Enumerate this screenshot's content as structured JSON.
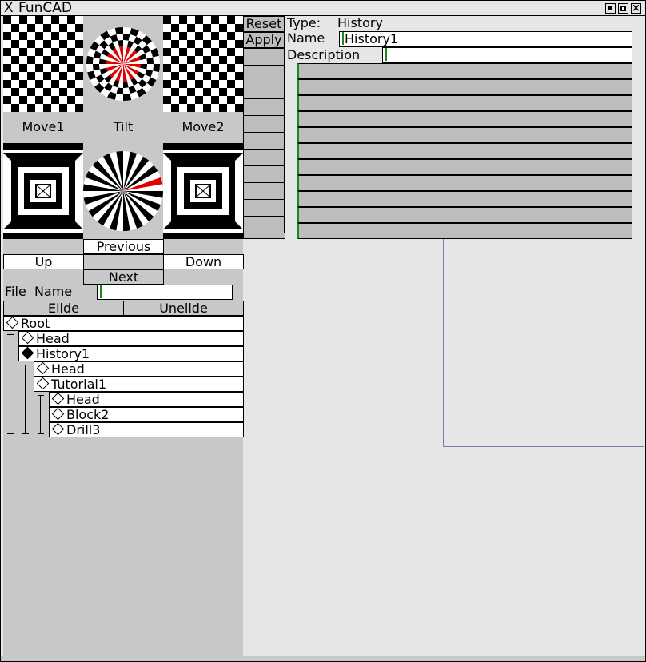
{
  "window": {
    "app_icon": "X",
    "title": "FunCAD",
    "controls": [
      "minimize-icon",
      "maximize-icon",
      "close-icon"
    ]
  },
  "views": {
    "move1": "Move1",
    "tilt": "Tilt",
    "move2": "Move2"
  },
  "nav": {
    "previous": "Previous",
    "up": "Up",
    "down": "Down",
    "next": "Next"
  },
  "file": {
    "label": "File  Name",
    "value": ""
  },
  "tree_buttons": {
    "elide": "Elide",
    "unelide": "Unelide"
  },
  "tree": [
    {
      "label": "Root",
      "level": 0,
      "selected": false
    },
    {
      "label": "Head",
      "level": 1,
      "selected": false
    },
    {
      "label": "History1",
      "level": 1,
      "selected": true
    },
    {
      "label": "Head",
      "level": 2,
      "selected": false
    },
    {
      "label": "Tutorial1",
      "level": 2,
      "selected": false
    },
    {
      "label": "Head",
      "level": 3,
      "selected": false
    },
    {
      "label": "Block2",
      "level": 3,
      "selected": false
    },
    {
      "label": "Drill3",
      "level": 3,
      "selected": false
    }
  ],
  "actions": {
    "reset": "Reset",
    "apply": "Apply"
  },
  "props": {
    "type_label": "Type:",
    "type_value": "History",
    "name_label": "Name",
    "name_value": "History1",
    "description_label": "Description",
    "description_value": ""
  },
  "colors": {
    "window_bg": "#e6e6e6",
    "panel_bg": "#c8c8c8",
    "row_bg": "#bdbdbd",
    "cursor": "#1a8a1a",
    "accent_red": "#e00000",
    "frame_line": "#7a7ab8"
  }
}
